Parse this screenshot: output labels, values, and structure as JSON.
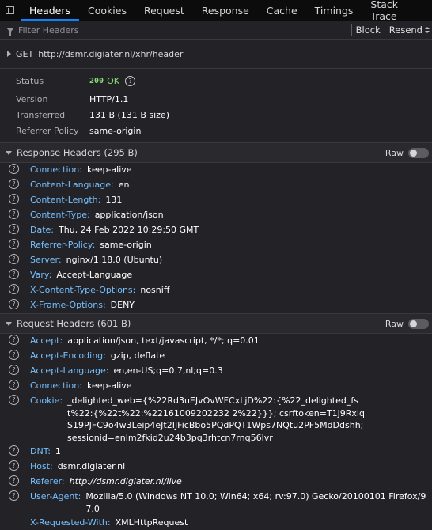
{
  "tabs": [
    "Headers",
    "Cookies",
    "Request",
    "Response",
    "Cache",
    "Timings",
    "Stack Trace"
  ],
  "filter": {
    "placeholder": "Filter Headers",
    "block_label": "Block",
    "resend_label": "Resend"
  },
  "request": {
    "method": "GET",
    "url": "http://dsmr.digiater.nl/xhr/header"
  },
  "summary": {
    "status_label": "Status",
    "status_code": "200",
    "status_text": "OK",
    "version_label": "Version",
    "version": "HTTP/1.1",
    "transferred_label": "Transferred",
    "transferred": "131 B (131 B size)",
    "referrer_label": "Referrer Policy",
    "referrer": "same-origin"
  },
  "response_headers": {
    "title": "Response Headers (295 B)",
    "raw_label": "Raw",
    "items": [
      {
        "name": "Connection:",
        "value": "keep-alive"
      },
      {
        "name": "Content-Language:",
        "value": "en"
      },
      {
        "name": "Content-Length:",
        "value": "131"
      },
      {
        "name": "Content-Type:",
        "value": "application/json"
      },
      {
        "name": "Date:",
        "value": "Thu, 24 Feb 2022 10:29:50 GMT"
      },
      {
        "name": "Referrer-Policy:",
        "value": "same-origin"
      },
      {
        "name": "Server:",
        "value": "nginx/1.18.0 (Ubuntu)"
      },
      {
        "name": "Vary:",
        "value": "Accept-Language"
      },
      {
        "name": "X-Content-Type-Options:",
        "value": "nosniff"
      },
      {
        "name": "X-Frame-Options:",
        "value": "DENY"
      }
    ]
  },
  "request_headers": {
    "title": "Request Headers (601 B)",
    "raw_label": "Raw",
    "items": [
      {
        "name": "Accept:",
        "value": "application/json, text/javascript, */*; q=0.01"
      },
      {
        "name": "Accept-Encoding:",
        "value": "gzip, deflate"
      },
      {
        "name": "Accept-Language:",
        "value": "en,en-US;q=0.7,nl;q=0.3"
      },
      {
        "name": "Connection:",
        "value": "keep-alive"
      },
      {
        "name": "Cookie:",
        "value": "_delighted_web={%22Rd3uEJvOvWFCxLjD%22:{%22_delighted_fst%22:{%22t%22:%22161009202232 2%22}}}; csrftoken=T1j9RxlqS19PJFC9o4w3Leip4eJt2IJFicBbo5PQdPQT1Wps7NQtu2PF5MdDdshh; sessionid=enlm2fkid2u24b3pq3rhtcn7rnq56lvr"
      },
      {
        "name": "DNT:",
        "value": "1"
      },
      {
        "name": "Host:",
        "value": "dsmr.digiater.nl"
      },
      {
        "name": "Referer:",
        "value": "http://dsmr.digiater.nl/live"
      },
      {
        "name": "User-Agent:",
        "value": "Mozilla/5.0 (Windows NT 10.0; Win64; x64; rv:97.0) Gecko/20100101 Firefox/97.0"
      },
      {
        "name": "X-Requested-With:",
        "value": "XMLHttpRequest"
      }
    ]
  }
}
